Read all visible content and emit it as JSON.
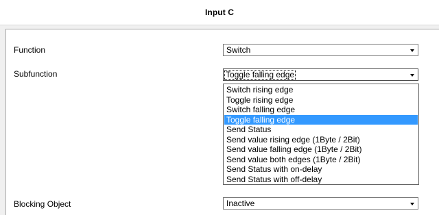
{
  "header": {
    "title": "Input C"
  },
  "params": {
    "function": {
      "label": "Function",
      "value": "Switch"
    },
    "subfunction": {
      "label": "Subfunction",
      "value": "Toggle falling edge"
    },
    "blocking": {
      "label": "Blocking Object",
      "value": "Inactive"
    }
  },
  "dropdown": {
    "selected_index": 3,
    "options": [
      "Switch rising edge",
      "Toggle rising edge",
      "Switch falling edge",
      "Toggle falling edge",
      "Send Status",
      "Send value rising edge (1Byte / 2Bit)",
      "Send value falling edge (1Byte / 2Bit)",
      "Send value both edges (1Byte / 2Bit)",
      "Send Status with on-delay",
      "Send Status with off-delay"
    ]
  },
  "colors": {
    "selection": "#3399ff",
    "panel_bg": "#ffffff",
    "window_bg": "#f0f0f0"
  }
}
